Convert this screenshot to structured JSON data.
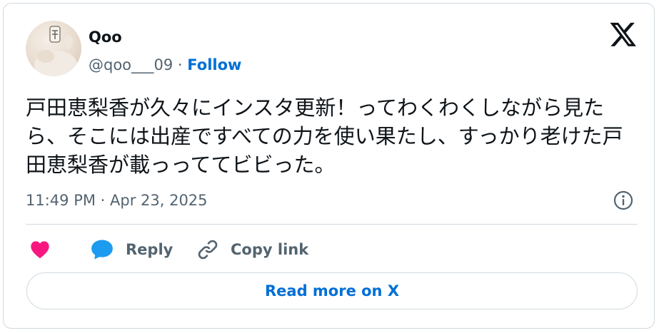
{
  "author": {
    "name": "Qoo",
    "handle": "@qoo___09",
    "separator": " · ",
    "follow_label": "Follow"
  },
  "tweet": {
    "text": "戸田恵梨香が久々にインスタ更新！ってわくわくしながら見たら、そこには出産ですべての力を使い果たし、すっかり老けた戸田恵梨香が載っっててビビった。",
    "timestamp": "11:49 PM · Apr 23, 2025"
  },
  "actions": {
    "reply_label": "Reply",
    "copy_label": "Copy link",
    "read_more_label": "Read more on X"
  },
  "icons": {
    "brand": "x-logo-icon",
    "info": "info-icon",
    "like": "heart-icon",
    "reply": "reply-bubble-icon",
    "copy": "link-icon"
  },
  "colors": {
    "accent": "#006fd6",
    "like": "#f91880",
    "reply": "#1d9bf0",
    "secondary_text": "#536471",
    "border": "#cfd9de"
  }
}
